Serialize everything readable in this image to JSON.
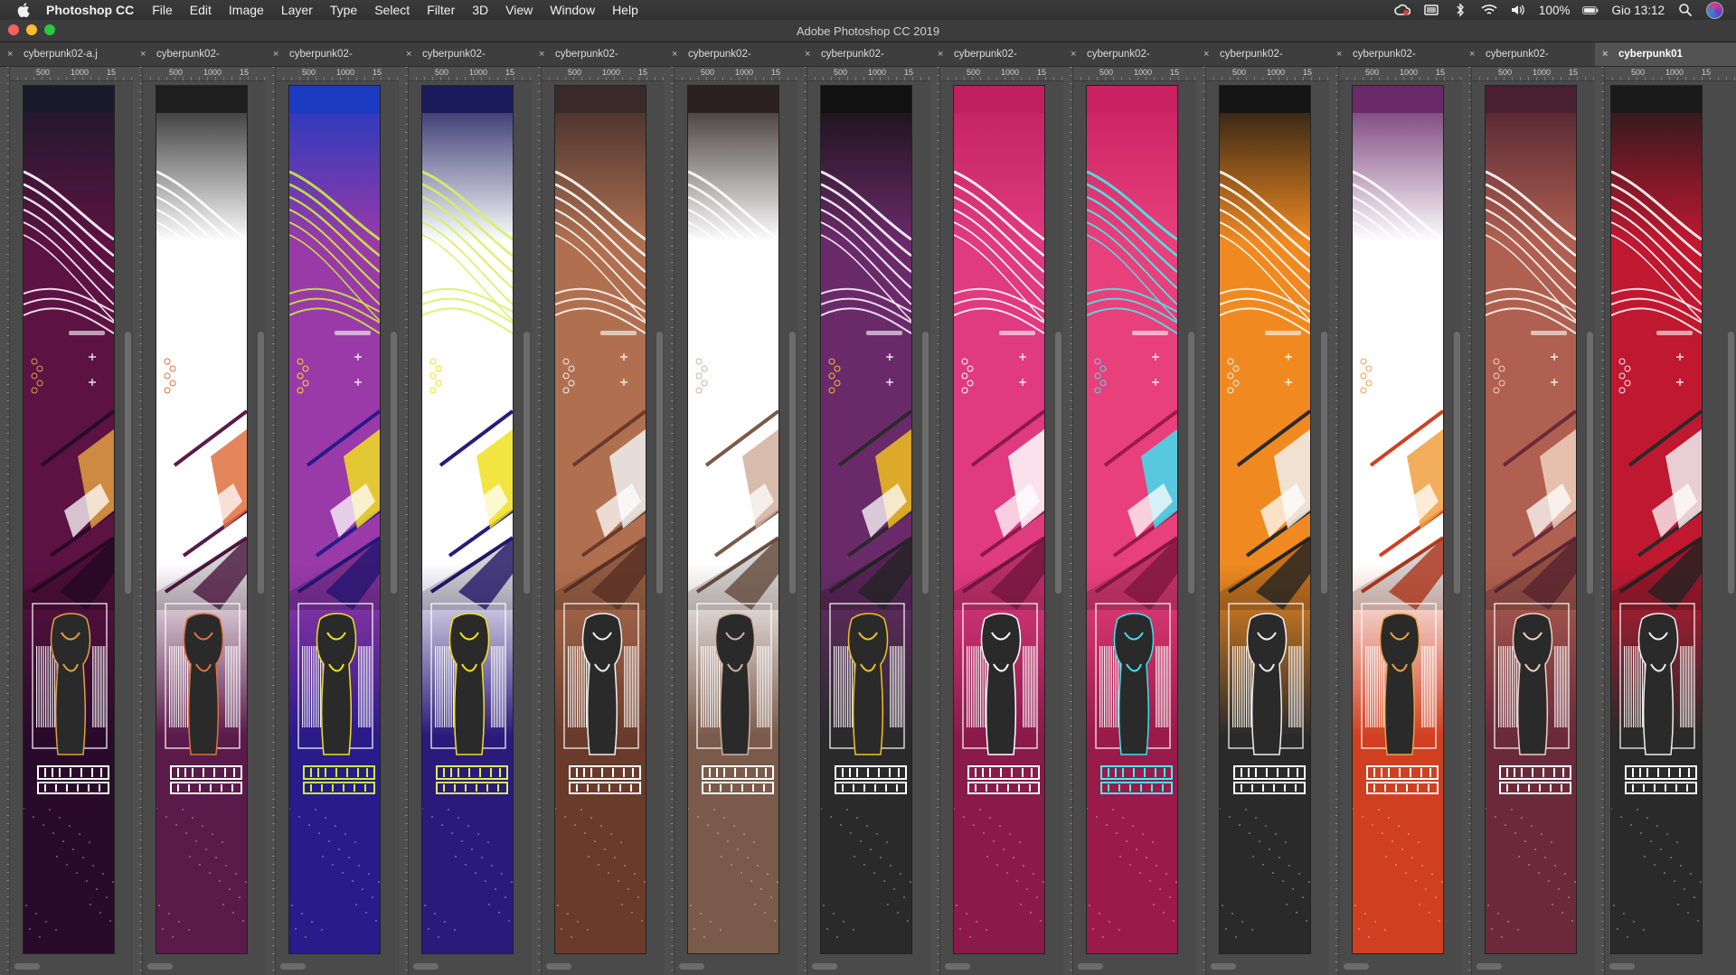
{
  "menubar": {
    "app_name": "Photoshop CC",
    "menus": [
      "File",
      "Edit",
      "Image",
      "Layer",
      "Type",
      "Select",
      "Filter",
      "3D",
      "View",
      "Window",
      "Help"
    ],
    "battery": "100%",
    "datetime": "Gio 13:12"
  },
  "window": {
    "title": "Adobe Photoshop CC 2019"
  },
  "ruler_labels": [
    "500",
    "1000",
    "15"
  ],
  "documents": [
    {
      "tab": "cyberpunk02-a.j",
      "colors": {
        "bg": "#5c1242",
        "bg2": "#2a0a2a",
        "top": "#1a1a2a",
        "accent": "#e0a040",
        "stripe": "#ffffff"
      }
    },
    {
      "tab": "cyberpunk02-",
      "colors": {
        "bg": "#ffffff",
        "bg2": "#5a1a4a",
        "top": "#1e1e1e",
        "accent": "#e07040",
        "stripe": "#ffffff"
      }
    },
    {
      "tab": "cyberpunk02-",
      "colors": {
        "bg": "#9a3aa8",
        "bg2": "#2a1a8a",
        "top": "#1a3ac0",
        "accent": "#f0e020",
        "stripe": "#c8f040"
      }
    },
    {
      "tab": "cyberpunk02-",
      "colors": {
        "bg": "#ffffff",
        "bg2": "#2a1a7a",
        "top": "#1a1a5a",
        "accent": "#f0e020",
        "stripe": "#d8f060"
      }
    },
    {
      "tab": "cyberpunk02-",
      "colors": {
        "bg": "#b07050",
        "bg2": "#6a3a2a",
        "top": "#3a2a2a",
        "accent": "#f0f0f0",
        "stripe": "#ffffff"
      }
    },
    {
      "tab": "cyberpunk02-",
      "colors": {
        "bg": "#ffffff",
        "bg2": "#7a5a4a",
        "top": "#2a2020",
        "accent": "#d0b0a0",
        "stripe": "#ffffff"
      }
    },
    {
      "tab": "cyberpunk02-",
      "colors": {
        "bg": "#6a2a6a",
        "bg2": "#2a2a2a",
        "top": "#111111",
        "accent": "#f0c020",
        "stripe": "#ffffff"
      }
    },
    {
      "tab": "cyberpunk02-",
      "colors": {
        "bg": "#e03a80",
        "bg2": "#8a1a4a",
        "top": "#c02060",
        "accent": "#ffffff",
        "stripe": "#ffffff"
      }
    },
    {
      "tab": "cyberpunk02-",
      "colors": {
        "bg": "#e8407a",
        "bg2": "#9a1a4a",
        "top": "#c82060",
        "accent": "#40e0f0",
        "stripe": "#40f0f0"
      }
    },
    {
      "tab": "cyberpunk02-",
      "colors": {
        "bg": "#f08a20",
        "bg2": "#2a2a2a",
        "top": "#151515",
        "accent": "#f0f0f0",
        "stripe": "#ffffff"
      }
    },
    {
      "tab": "cyberpunk02-",
      "colors": {
        "bg": "#ffffff",
        "bg2": "#d04020",
        "top": "#6a2a6a",
        "accent": "#f0a040",
        "stripe": "#ffffff"
      }
    },
    {
      "tab": "cyberpunk02-",
      "colors": {
        "bg": "#b06050",
        "bg2": "#6a2a3a",
        "top": "#4a2030",
        "accent": "#f0d0c0",
        "stripe": "#ffffff"
      }
    },
    {
      "tab": "cyberpunk01",
      "colors": {
        "bg": "#c01830",
        "bg2": "#2a2a2a",
        "top": "#1a1a1a",
        "accent": "#f0f0f0",
        "stripe": "#ffffff"
      },
      "active": true
    }
  ]
}
